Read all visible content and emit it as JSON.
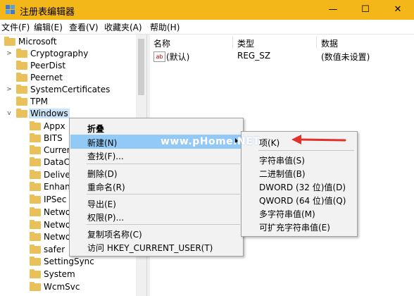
{
  "window": {
    "title": "注册表编辑器",
    "minimize": "—",
    "maximize": "☐",
    "close": "✕"
  },
  "menubar": [
    "文件(F)",
    "编辑(E)",
    "查看(V)",
    "收藏夹(A)",
    "帮助(H)"
  ],
  "tree": {
    "items": [
      {
        "label": "Microsoft",
        "expander": ""
      },
      {
        "label": "Cryptography",
        "expander": ">"
      },
      {
        "label": "PeerDist",
        "expander": ""
      },
      {
        "label": "Peernet",
        "expander": ""
      },
      {
        "label": "SystemCertificates",
        "expander": ">"
      },
      {
        "label": "TPM",
        "expander": ""
      },
      {
        "label": "Windows",
        "expander": "v"
      },
      {
        "label": "Appx",
        "expander": ""
      },
      {
        "label": "BITS",
        "expander": ""
      },
      {
        "label": "Curren",
        "expander": ""
      },
      {
        "label": "DataC",
        "expander": ""
      },
      {
        "label": "Delive",
        "expander": ""
      },
      {
        "label": "Enhan",
        "expander": ""
      },
      {
        "label": "IPSec",
        "expander": ""
      },
      {
        "label": "Netwo",
        "expander": ""
      },
      {
        "label": "Netwo",
        "expander": ""
      },
      {
        "label": "Netwo",
        "expander": ""
      },
      {
        "label": "safer",
        "expander": ""
      },
      {
        "label": "SettingSync",
        "expander": ""
      },
      {
        "label": "System",
        "expander": ""
      },
      {
        "label": "WcmSvc",
        "expander": ""
      }
    ]
  },
  "values": {
    "columns": [
      "名称",
      "类型",
      "数据"
    ],
    "rows": [
      {
        "name": "(默认)",
        "type": "REG_SZ",
        "data": "(数值未设置)",
        "icon": "ab"
      }
    ]
  },
  "context_menu": {
    "items": [
      "折叠",
      "新建(N)",
      "查找(F)...",
      "删除(D)",
      "重命名(R)",
      "导出(E)",
      "权限(P)...",
      "复制项名称(C)",
      "访问 HKEY_CURRENT_USER(T)"
    ]
  },
  "submenu": {
    "items": [
      "项(K)",
      "字符串值(S)",
      "二进制值(B)",
      "DWORD (32 位)值(D)",
      "QWORD (64 位)值(Q)",
      "多字符串值(M)",
      "可扩充字符串值(E)"
    ]
  },
  "watermark": "www.pHome.NET",
  "colors": {
    "titlebar": "#f4b71a",
    "highlight": "#91c9f7",
    "arrow": "#e0312b"
  }
}
